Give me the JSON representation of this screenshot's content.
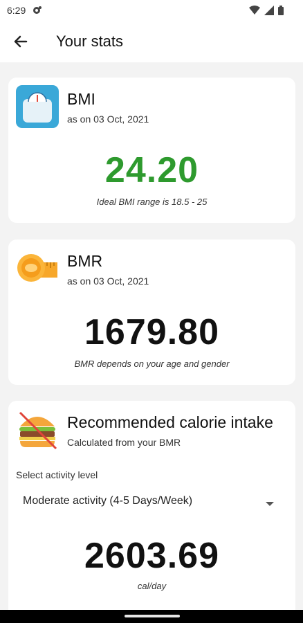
{
  "status": {
    "time": "6:29"
  },
  "appbar": {
    "title": "Your stats"
  },
  "bmi": {
    "title": "BMI",
    "date": "as on 03 Oct, 2021",
    "value": "24.20",
    "note": "Ideal BMI range is 18.5 - 25",
    "value_color": "#2e9a2e"
  },
  "bmr": {
    "title": "BMR",
    "date": "as on 03 Oct, 2021",
    "value": "1679.80",
    "note": "BMR depends on your age and gender"
  },
  "calorie": {
    "title": "Recommended calorie intake",
    "subtitle": "Calculated from your BMR",
    "select_label": "Select activity level",
    "select_value": "Moderate activity (4-5 Days/Week)",
    "value": "2603.69",
    "unit": "cal/day"
  }
}
